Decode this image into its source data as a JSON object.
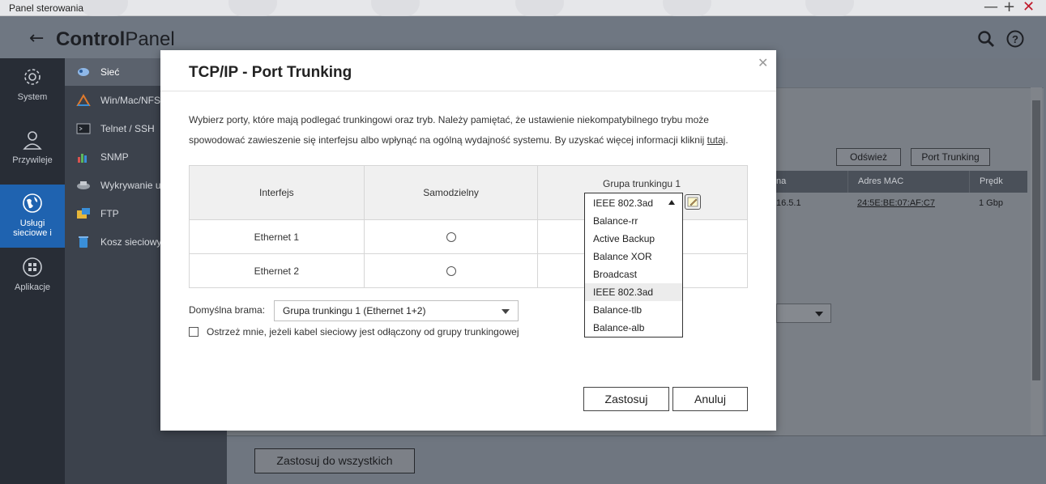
{
  "window": {
    "title": "Panel sterowania"
  },
  "header": {
    "title_bold": "Control",
    "title_light": "Panel"
  },
  "rail": [
    {
      "label": "System",
      "icon": "gear-icon"
    },
    {
      "label": "Przywileje",
      "icon": "user-icon"
    },
    {
      "label": "Usługi sieciowe i",
      "icon": "globe-icon",
      "active": true
    },
    {
      "label": "Aplikacje",
      "icon": "apps-grid-icon"
    }
  ],
  "nav": [
    {
      "label": "Sieć",
      "icon": "network-icon",
      "active": true
    },
    {
      "label": "Win/Mac/NFS",
      "icon": "triangle-icon"
    },
    {
      "label": "Telnet / SSH",
      "icon": "terminal-icon"
    },
    {
      "label": "SNMP",
      "icon": "bar-chart-icon"
    },
    {
      "label": "Wykrywanie u",
      "icon": "discovery-icon"
    },
    {
      "label": "FTP",
      "icon": "ftp-icon"
    },
    {
      "label": "Kosz sieciowy",
      "icon": "recycle-bin-icon"
    }
  ],
  "background": {
    "refresh_label": "Odśwież",
    "port_trunking_label": "Port Trunking",
    "col_name_partial": "na",
    "col_mac": "Adres MAC",
    "col_speed_partial": "Prędk",
    "row_ip_partial": "16.5.1",
    "row_mac": "24:5E:BE:07:AF:C7",
    "row_speed": "1 Gbp",
    "apply_all_label": "Zastosuj do wszystkich"
  },
  "modal": {
    "title": "TCP/IP - Port Trunking",
    "desc_line1": "Wybierz porty, które mają podlegać trunkingowi oraz tryb. Należy pamiętać, że ustawienie niekompatybilnego trybu może",
    "desc_line2": "spowodować zawieszenie się interfejsu albo wpłynąć na ogólną wydajność systemu. By uzyskać więcej informacji kliknij ",
    "desc_link": "tutaj",
    "desc_end": ".",
    "table": {
      "col_interface": "Interfejs",
      "col_standalone": "Samodzielny",
      "col_group": "Grupa trunkingu 1",
      "rows": [
        {
          "name": "Ethernet 1"
        },
        {
          "name": "Ethernet 2"
        }
      ]
    },
    "gateway_label": "Domyślna brama:",
    "gateway_value": "Grupa trunkingu 1 (Ethernet 1+2)",
    "warn_label": "Ostrzeż mnie, jeżeli kabel sieciowy jest odłączony od grupy trunkingowej",
    "apply_label": "Zastosuj",
    "cancel_label": "Anuluj",
    "mode_select": {
      "value": "IEEE 802.3ad",
      "options": [
        "Balance-rr",
        "Active Backup",
        "Balance XOR",
        "Broadcast",
        "IEEE 802.3ad",
        "Balance-tlb",
        "Balance-alb"
      ],
      "selected_index": 4
    }
  },
  "colors": {
    "accent": "#1f63b0",
    "rail_bg": "#282d36",
    "nav_bg": "#3c424c"
  }
}
